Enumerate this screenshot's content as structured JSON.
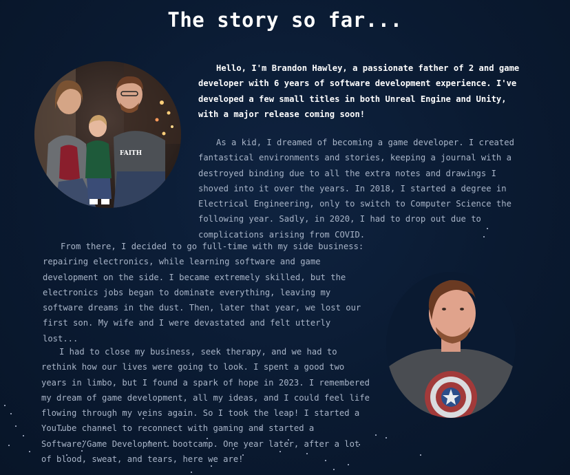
{
  "page": {
    "title": "The story so far..."
  },
  "story": {
    "paragraphs": [
      "Hello, I'm Brandon Hawley, a passionate father of 2 and game developer with 6 years of software development experience. I've developed a few small titles in both Unreal Engine and Unity, with a major release coming soon!",
      "As a kid, I dreamed of becoming a game developer. I created fantastical environments and stories, keeping a journal with a destroyed binding due to all the extra notes and drawings I shoved into it over the years. In 2018, I started a degree in Electrical Engineering, only to switch to Computer Science the following year. Sadly, in 2020, I had to drop out due to complications arising from COVID.",
      "From there, I decided to go full-time with my side business: repairing electronics, while learning software and game development on the side. I became extremely skilled, but the electronics jobs began to dominate everything, leaving my software dreams in the dust. Then, later that year, we lost our first son. My wife and I were devastated and felt utterly lost...",
      "I had to close my business, seek therapy, and we had to rethink how our lives were going to look. I spent a good two years in limbo, but I found a spark of hope in 2023. I remembered my dream of game development, all my ideas, and I could feel life flowing through my veins again. So I took the leap! I started a YouTube channel to reconnect with gaming and started a Software/Game Development bootcamp. One year later, after a lot of blood, sweat, and tears, here we are!"
    ]
  },
  "photos": {
    "family_shirt_text": "FAITH"
  },
  "colors": {
    "background": "#0a1a31",
    "highlight_text": "#ffffff",
    "body_text": "#a9b5c8",
    "star": "#dfe8ff"
  }
}
